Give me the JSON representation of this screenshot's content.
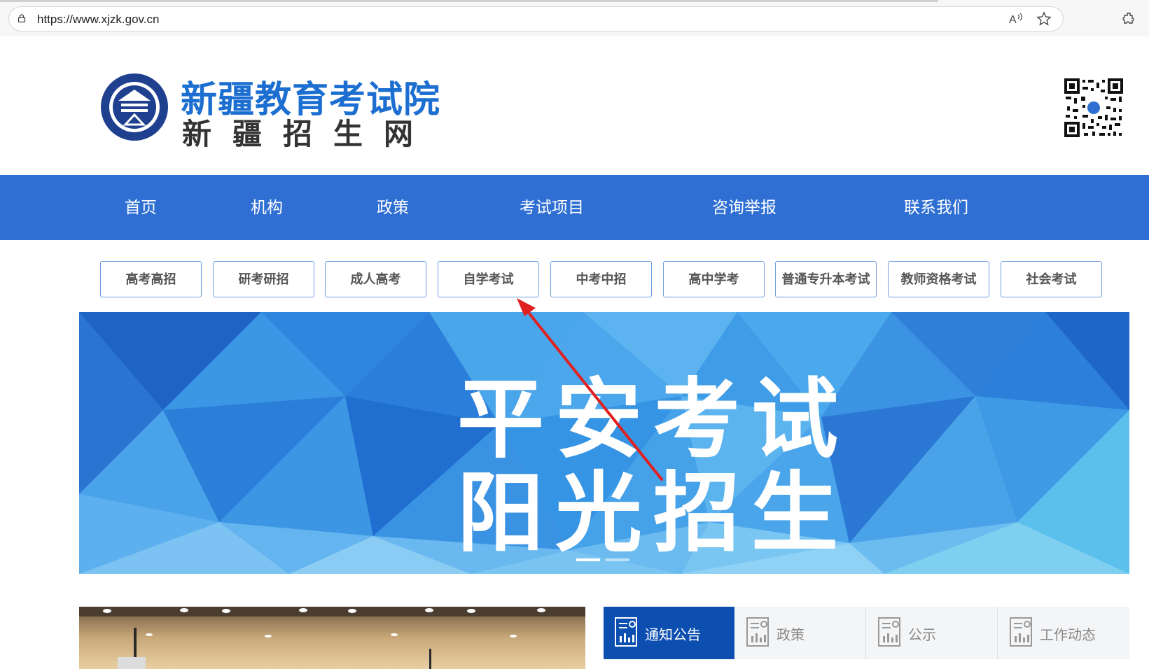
{
  "browser": {
    "url": "https://www.xjzk.gov.cn"
  },
  "header": {
    "title": "新疆教育考试院",
    "subtitle": "新疆招生网",
    "emblem_text": "新疆教育考试院"
  },
  "nav": {
    "items": [
      {
        "label": "首页"
      },
      {
        "label": "机构"
      },
      {
        "label": "政策"
      },
      {
        "label": "考试项目"
      },
      {
        "label": "咨询举报"
      },
      {
        "label": "联系我们"
      }
    ]
  },
  "categories": [
    {
      "label": "高考高招"
    },
    {
      "label": "研考研招"
    },
    {
      "label": "成人高考"
    },
    {
      "label": "自学考试"
    },
    {
      "label": "中考中招"
    },
    {
      "label": "高中学考"
    },
    {
      "label": "普通专升本考试"
    },
    {
      "label": "教师资格考试"
    },
    {
      "label": "社会考试"
    }
  ],
  "banner": {
    "line1": "平安考试",
    "line2": "阳光招生",
    "slides": 2,
    "active_slide": 1
  },
  "tabs": [
    {
      "label": "通知公告",
      "active": true
    },
    {
      "label": "政策",
      "active": false
    },
    {
      "label": "公示",
      "active": false
    },
    {
      "label": "工作动态",
      "active": false
    }
  ],
  "colors": {
    "nav_bg": "#2f6fd4",
    "brand_blue": "#1c6fd0",
    "tab_active": "#0d4fb0",
    "annotation_arrow": "#e02020"
  }
}
